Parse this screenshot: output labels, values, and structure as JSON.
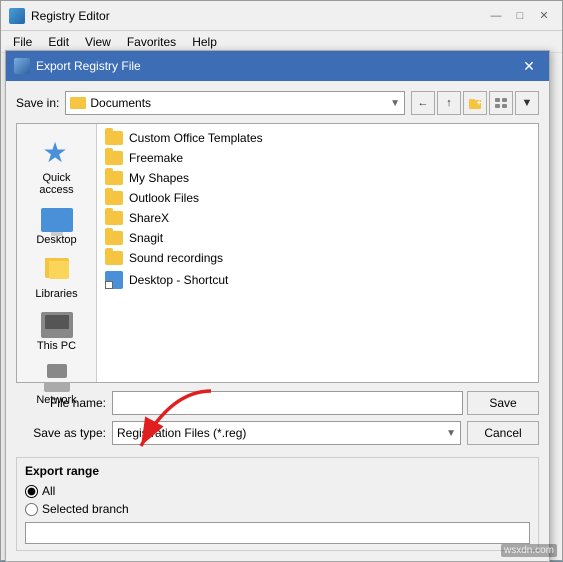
{
  "registry_editor": {
    "title": "Registry Editor",
    "menu": {
      "file": "File",
      "edit": "Edit",
      "view": "View",
      "favorites": "Favorites",
      "help": "Help"
    },
    "window_controls": {
      "minimize": "—",
      "maximize": "□",
      "close": "✕"
    }
  },
  "dialog": {
    "title": "Export Registry File",
    "close_btn": "✕",
    "save_in_label": "Save in:",
    "save_in_value": "Documents",
    "toolbar": {
      "back": "←",
      "up": "↑",
      "new_folder": "📁",
      "view": "☰"
    },
    "sidebar": {
      "items": [
        {
          "id": "quick-access",
          "label": "Quick access"
        },
        {
          "id": "desktop",
          "label": "Desktop"
        },
        {
          "id": "libraries",
          "label": "Libraries"
        },
        {
          "id": "this-pc",
          "label": "This PC"
        },
        {
          "id": "network",
          "label": "Network"
        }
      ]
    },
    "file_list": [
      {
        "name": "Custom Office Templates",
        "type": "folder"
      },
      {
        "name": "Freemake",
        "type": "folder"
      },
      {
        "name": "My Shapes",
        "type": "folder"
      },
      {
        "name": "Outlook Files",
        "type": "folder"
      },
      {
        "name": "ShareX",
        "type": "folder"
      },
      {
        "name": "Snagit",
        "type": "folder"
      },
      {
        "name": "Sound recordings",
        "type": "folder"
      },
      {
        "name": "Desktop - Shortcut",
        "type": "shortcut"
      }
    ],
    "filename_label": "File name:",
    "filename_value": "",
    "filename_placeholder": "",
    "savetype_label": "Save as type:",
    "savetype_value": "Registration Files (*.reg)",
    "save_btn": "Save",
    "cancel_btn": "Cancel",
    "export_range": {
      "title": "Export range",
      "options": [
        {
          "id": "all",
          "label": "All",
          "checked": true
        },
        {
          "id": "selected",
          "label": "Selected branch",
          "checked": false
        }
      ],
      "branch_input_value": ""
    }
  },
  "watermark": "wsxdn.com"
}
